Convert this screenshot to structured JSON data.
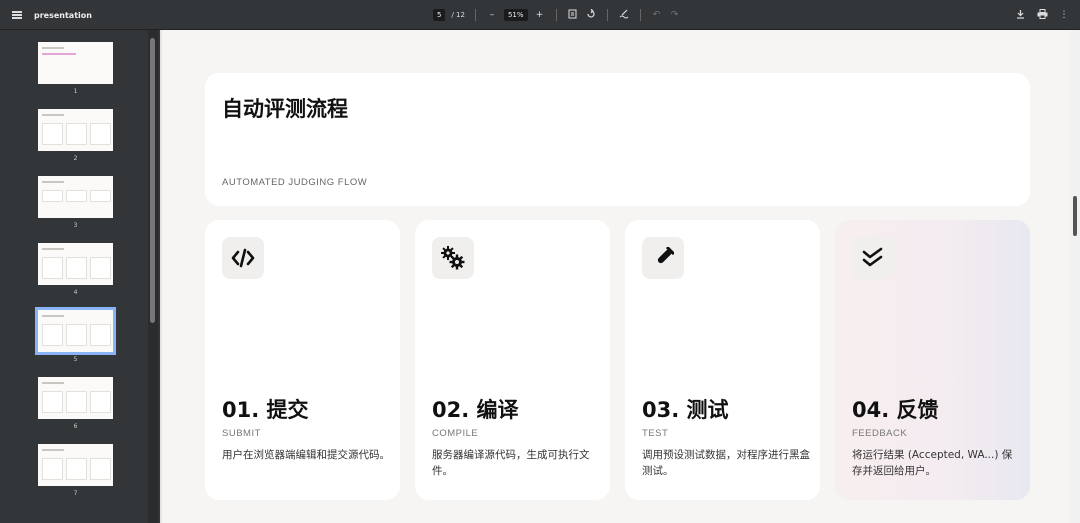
{
  "toolbar": {
    "title": "presentation",
    "page_current": "5",
    "page_total": "/ 12",
    "zoom": "51%",
    "zoom_out": "–",
    "zoom_in": "+"
  },
  "sidebar": {
    "thumbnails": [
      {
        "number": "1"
      },
      {
        "number": "2"
      },
      {
        "number": "3"
      },
      {
        "number": "4"
      },
      {
        "number": "5",
        "active": true
      },
      {
        "number": "6"
      },
      {
        "number": "7"
      }
    ]
  },
  "slide": {
    "title": "自动评测流程",
    "subtitle": "AUTOMATED JUDGING FLOW",
    "cards": [
      {
        "icon": "code-icon",
        "title": "01. 提交",
        "en": "SUBMIT",
        "desc": "用户在浏览器端编辑和提交源代码。"
      },
      {
        "icon": "gears-icon",
        "title": "02. 编译",
        "en": "COMPILE",
        "desc": "服务器编译源代码，生成可执行文件。"
      },
      {
        "icon": "test-tube-icon",
        "title": "03. 测试",
        "en": "TEST",
        "desc": "调用预设测试数据，对程序进行黑盒测试。"
      },
      {
        "icon": "double-check-icon",
        "title": "04. 反馈",
        "en": "FEEDBACK",
        "desc": "将运行结果 (Accepted, WA...) 保存并返回给用户。"
      }
    ]
  },
  "colors": {
    "toolbar_bg": "#323639",
    "active_outline": "#8ab4f8",
    "slide_bg": "#f6f5f3"
  }
}
